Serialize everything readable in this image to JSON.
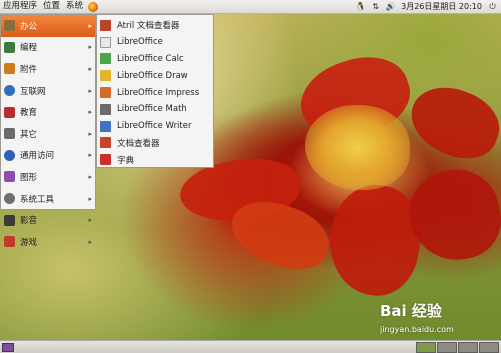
{
  "top_panel": {
    "menus": [
      "应用程序",
      "位置",
      "系统"
    ],
    "datetime": "3月26日星期日 20:10"
  },
  "main_menu": {
    "categories": [
      {
        "label": "办公",
        "icon": "office-icon",
        "color": "#8a6d3b",
        "active": true
      },
      {
        "label": "编程",
        "icon": "programming-icon",
        "color": "#3d7a3d"
      },
      {
        "label": "附件",
        "icon": "accessories-icon",
        "color": "#c97d1f"
      },
      {
        "label": "互联网",
        "icon": "internet-icon",
        "color": "#2f6fb5"
      },
      {
        "label": "教育",
        "icon": "education-icon",
        "color": "#b52f2f"
      },
      {
        "label": "其它",
        "icon": "other-icon",
        "color": "#6a6a6a"
      },
      {
        "label": "通用访问",
        "icon": "accessibility-icon",
        "color": "#2d62b8"
      },
      {
        "label": "图形",
        "icon": "graphics-icon",
        "color": "#8b4fa8"
      },
      {
        "label": "系统工具",
        "icon": "system-tools-icon",
        "color": "#6e6e6e"
      },
      {
        "label": "影音",
        "icon": "multimedia-icon",
        "color": "#3a3a3a"
      },
      {
        "label": "游戏",
        "icon": "games-icon",
        "color": "#c23a2a"
      }
    ]
  },
  "office_submenu": {
    "items": [
      {
        "label": "Atril 文档查看器",
        "icon": "atril-icon",
        "color": "#b8442a"
      },
      {
        "label": "LibreOffice",
        "icon": "libreoffice-icon",
        "color": "#e8e8e8"
      },
      {
        "label": "LibreOffice Calc",
        "icon": "libreoffice-calc-icon",
        "color": "#4aa84a"
      },
      {
        "label": "LibreOffice Draw",
        "icon": "libreoffice-draw-icon",
        "color": "#e3b52b"
      },
      {
        "label": "LibreOffice Impress",
        "icon": "libreoffice-impress-icon",
        "color": "#d76a2b"
      },
      {
        "label": "LibreOffice Math",
        "icon": "libreoffice-math-icon",
        "color": "#6a6a6a"
      },
      {
        "label": "LibreOffice Writer",
        "icon": "libreoffice-writer-icon",
        "color": "#3f73c4"
      },
      {
        "label": "文档查看器",
        "icon": "document-viewer-icon",
        "color": "#c8432c"
      },
      {
        "label": "字典",
        "icon": "dictionary-icon",
        "color": "#c8302c"
      }
    ]
  },
  "watermark": {
    "brand": "Bai 经验",
    "url": "jingyan.baidu.com"
  }
}
